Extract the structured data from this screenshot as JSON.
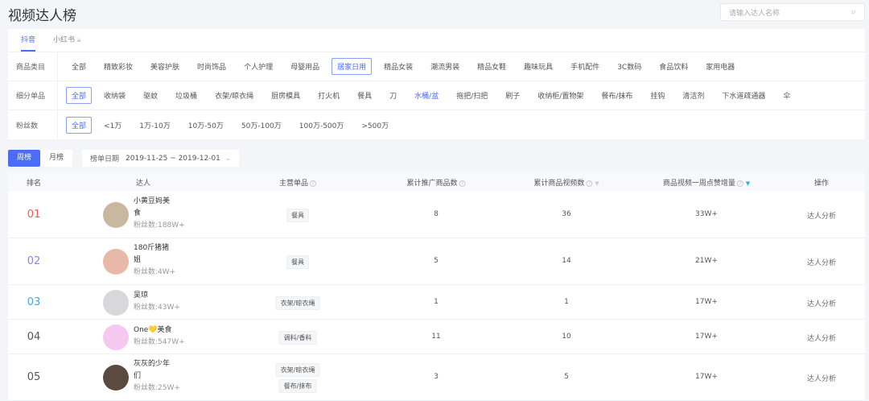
{
  "header": {
    "title": "视频达人榜",
    "search_placeholder": "请输入达人名称",
    "search_icon": "search-icon"
  },
  "platform_tabs": [
    {
      "label": "抖音",
      "active": true
    },
    {
      "label": "小红书",
      "locked": true
    }
  ],
  "filters": [
    {
      "label": "商品类目",
      "options": [
        "全部",
        "精致彩妆",
        "美容护肤",
        "时尚饰品",
        "个人护理",
        "母婴用品",
        "居家日用",
        "精品女装",
        "潮流男装",
        "精品女鞋",
        "趣味玩具",
        "手机配件",
        "3C数码",
        "食品饮料",
        "家用电器"
      ],
      "selected": "居家日用"
    },
    {
      "label": "细分单品",
      "options": [
        "全部",
        "收纳袋",
        "驱蚊",
        "垃圾桶",
        "衣架/晾衣绳",
        "厨房模具",
        "打火机",
        "餐具",
        "刀",
        "水桶/盆",
        "拖把/扫把",
        "刷子",
        "收纳柜/置物架",
        "餐布/抹布",
        "挂钩",
        "清洁剂",
        "下水道疏通器",
        "伞"
      ],
      "selected": "全部",
      "highlighted": "水桶/盆"
    },
    {
      "label": "粉丝数",
      "options": [
        "全部",
        "<1万",
        "1万-10万",
        "10万-50万",
        "50万-100万",
        "100万-500万",
        ">500万"
      ],
      "selected": "全部"
    }
  ],
  "period": {
    "options": [
      "周榜",
      "月榜"
    ],
    "selected": "周榜"
  },
  "date": {
    "label": "榜单日期",
    "value": "2019-11-25 ~ 2019-12-01"
  },
  "table": {
    "columns": [
      "排名",
      "达人",
      "主营单品",
      "累计推广商品数",
      "累计商品视频数",
      "商品视频一周点赞增量",
      "操作"
    ],
    "rows": [
      {
        "rank": "01",
        "name1": "小黄豆妈美",
        "name2": "食",
        "fans": "粉丝数:188W+",
        "tags": [
          "餐具"
        ],
        "products": "8",
        "videos": "36",
        "likes": "33W+",
        "action": "达人分析",
        "rank_color": "#f05a5a",
        "avatar_color": "#c9b8a0"
      },
      {
        "rank": "02",
        "name1": "180斤猪猪",
        "name2": "姐",
        "fans": "粉丝数:4W+",
        "tags": [
          "餐具"
        ],
        "products": "5",
        "videos": "14",
        "likes": "21W+",
        "action": "达人分析",
        "rank_color": "#9b7fe0",
        "avatar_color": "#e8b8a8"
      },
      {
        "rank": "03",
        "name1": "吴琼",
        "name2": "",
        "fans": "粉丝数:43W+",
        "tags": [
          "衣架/晾衣绳"
        ],
        "products": "1",
        "videos": "1",
        "likes": "17W+",
        "action": "达人分析",
        "rank_color": "#3fa6e8",
        "avatar_color": "#d8d8dc"
      },
      {
        "rank": "04",
        "name1": "One💛美食",
        "name2": "",
        "fans": "粉丝数:547W+",
        "tags": [
          "调料/香料"
        ],
        "products": "11",
        "videos": "10",
        "likes": "17W+",
        "action": "达人分析",
        "rank_color": "#555555",
        "avatar_color": "#f5c8f0"
      },
      {
        "rank": "05",
        "name1": "灰灰的少年",
        "name2": "们",
        "fans": "粉丝数:25W+",
        "tags": [
          "衣架/晾衣绳",
          "餐布/抹布"
        ],
        "products": "3",
        "videos": "5",
        "likes": "17W+",
        "action": "达人分析",
        "rank_color": "#555555",
        "avatar_color": "#5a4a40"
      }
    ]
  },
  "colors": {
    "accent": "#4a6cf7",
    "sort_active": "#2bb8d8"
  }
}
